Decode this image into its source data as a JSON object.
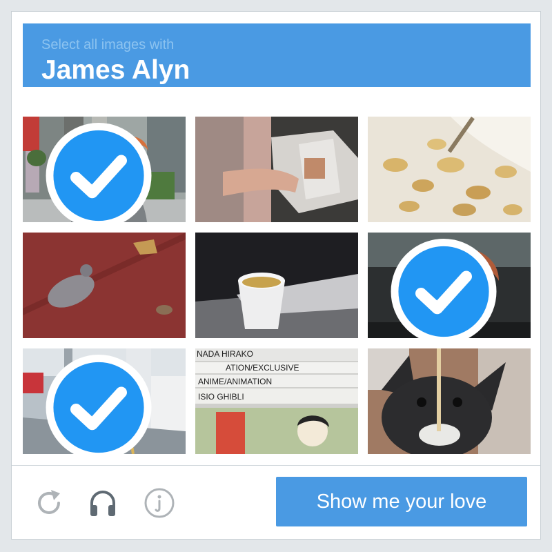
{
  "header": {
    "subtitle": "Select all images with",
    "title": "James Alyn"
  },
  "grid": {
    "tiles": [
      {
        "name": "tile-person-street",
        "selected": true
      },
      {
        "name": "tile-open-book",
        "selected": false
      },
      {
        "name": "tile-oat-flakes",
        "selected": false
      },
      {
        "name": "tile-pigeon-sparrow",
        "selected": false
      },
      {
        "name": "tile-paper-cup",
        "selected": false
      },
      {
        "name": "tile-person-closeup",
        "selected": true
      },
      {
        "name": "tile-person-platform",
        "selected": true
      },
      {
        "name": "tile-manga-rack",
        "selected": false
      },
      {
        "name": "tile-dog-noodle",
        "selected": false
      }
    ],
    "manga_labels": [
      "NADA HIRAKO",
      "ATION/EXCLUSIVE",
      "ANIME/ANIMATION",
      "ISIO GHIBLI"
    ]
  },
  "footer": {
    "refresh_icon": "refresh-icon",
    "audio_icon": "headphones-icon",
    "info_icon": "info-icon",
    "submit_label": "Show me your love"
  },
  "colors": {
    "accent": "#4a9ae3",
    "check": "#2196f3"
  }
}
